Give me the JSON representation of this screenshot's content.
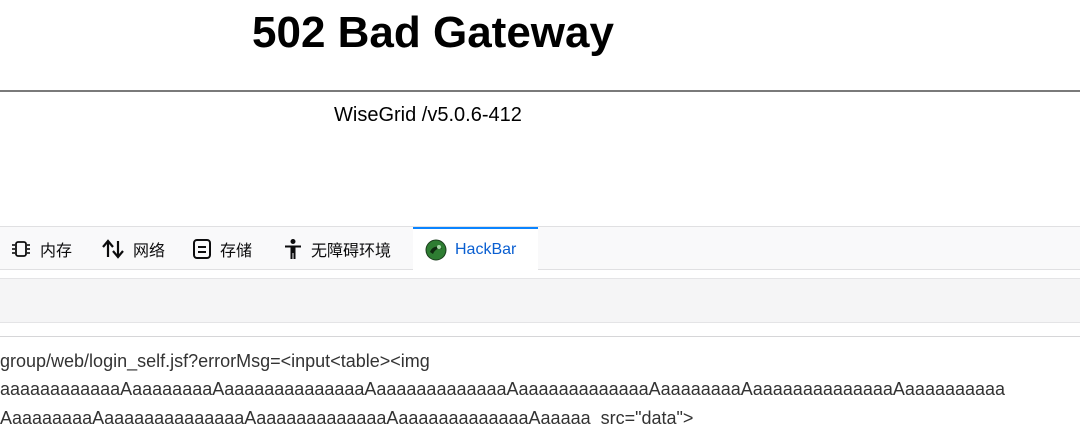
{
  "error_page": {
    "title": "502 Bad Gateway",
    "server": "WiseGrid /v5.0.6-412"
  },
  "devtools": {
    "tabs": [
      {
        "label": "内存",
        "icon": "memory-chip-icon"
      },
      {
        "label": "网络",
        "icon": "up-down-arrows-icon"
      },
      {
        "label": "存储",
        "icon": "storage-icon"
      },
      {
        "label": "无障碍环境",
        "icon": "accessibility-person-icon"
      },
      {
        "label": "HackBar",
        "icon": "hackbar-logo-icon",
        "active": true
      }
    ],
    "accent_color": "#0a84ff"
  },
  "hackbar": {
    "url_lines": [
      "group/web/login_self.jsf?errorMsg=<input<table><img",
      "aaaaaaaaaaaaAaaaaaaaaAaaaaaaaaaaaaaaAaaaaaaaaaaaaaAaaaaaaaaaaaaaAaaaaaaaaAaaaaaaaaaaaaaaAaaaaaaaaaa",
      "AaaaaaaaaAaaaaaaaaaaaaaaAaaaaaaaaaaaaaAaaaaaaaaaaaaaAaaaaa  src=\"data\">"
    ]
  }
}
